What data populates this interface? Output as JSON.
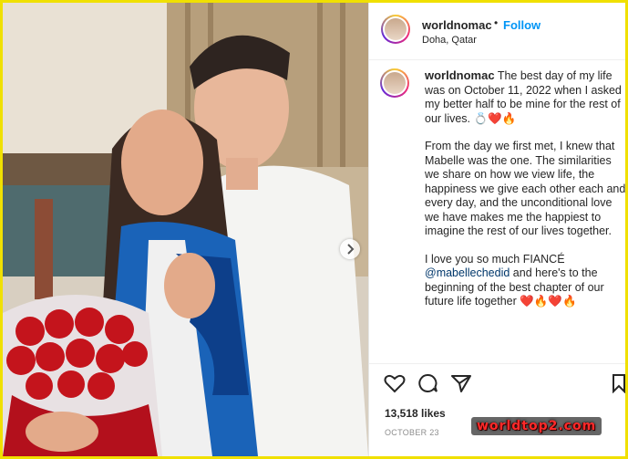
{
  "post": {
    "username": "worldnomac",
    "follow_label": "Follow",
    "separator": "•",
    "location": "Doha, Qatar"
  },
  "caption": {
    "username": "worldnomac",
    "para1": "The best day of my life was on October 11, 2022 when I asked my better half to be mine for the rest of our lives.",
    "para1_emoji": "💍❤️🔥",
    "para2": "From the day we first met, I knew that Mabelle was the one. The similarities we share on how we view life, the happiness we give each other each and every day, and the unconditional love we have makes me the happiest to imagine the rest of our lives together.",
    "para3_start": "I love you so much FIANCÉ",
    "mention": "@mabellechedid",
    "para3_end": "and here's to the beginning of the best chapter of our future life together",
    "para3_emoji": "❤️🔥❤️🔥"
  },
  "actions": {
    "likes": "13,518 likes",
    "date": "OCTOBER 23",
    "icons": [
      "heart-icon",
      "comment-icon",
      "share-icon",
      "bookmark-icon"
    ]
  },
  "watermark": "worldtop2.com",
  "colors": {
    "border": "#f0e000",
    "follow": "#0095f6",
    "text": "#262626",
    "muted": "#8e8e8e"
  }
}
